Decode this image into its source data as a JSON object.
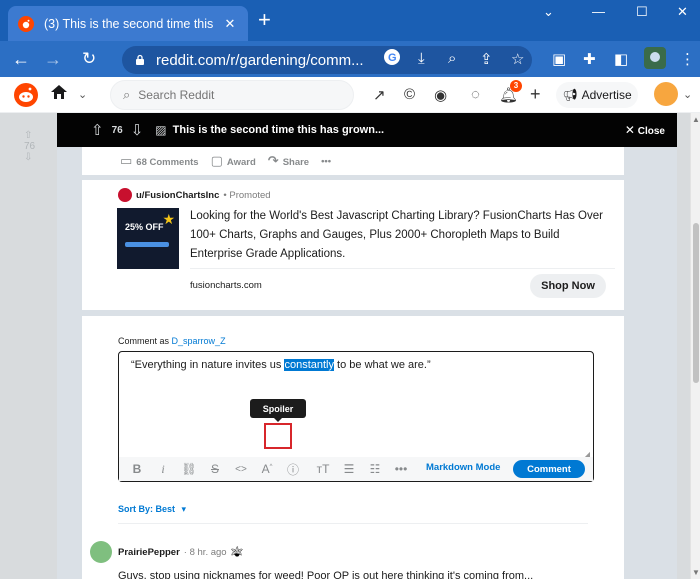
{
  "browser": {
    "tab_title": "(3) This is the second time this has",
    "url": "reddit.com/r/gardening/comm...",
    "new_tab": "+",
    "tab_close": "✕",
    "window_controls": [
      "⌄",
      "—",
      "☐",
      "✕"
    ]
  },
  "reddit_header": {
    "search_placeholder": "Search Reddit",
    "notification_count": "3",
    "advertise_label": "Advertise"
  },
  "post_bar": {
    "score": "76",
    "title": "This is the second time this has grown...",
    "close_label": "Close"
  },
  "post_actions": {
    "comments": "68 Comments",
    "award": "Award",
    "share": "Share",
    "more": "•••"
  },
  "promo": {
    "user": "u/FusionChartsInc",
    "promoted": "• Promoted",
    "image_text": "25% OFF",
    "description": "Looking for the World's Best Javascript Charting Library? FusionCharts Has Over 100+ Charts, Graphs and Gauges, Plus 2000+ Choropleth Maps to Build Enterprise Grade Applications.",
    "domain": "fusioncharts.com",
    "cta": "Shop Now"
  },
  "comment_box": {
    "comment_as": "Comment as",
    "username": "D_sparrow_Z",
    "text_before": "“Everything in nature invites us ",
    "text_selected": "constantly",
    "text_after": " to be what we are.”",
    "tooltip": "Spoiler",
    "markdown_mode": "Markdown Mode",
    "submit": "Comment"
  },
  "sort": {
    "label": "Sort By: Best"
  },
  "first_comment": {
    "user": "PrairiePepper",
    "time": "· 8 hr. ago",
    "preview": "Guys, stop using nicknames for weed! Poor OP is out here thinking it's coming from..."
  },
  "colors": {
    "reddit_orange": "#ff4500",
    "link_blue": "#0079d3",
    "browser_blue": "#1a5fb4",
    "highlight_red": "#d7262b"
  }
}
